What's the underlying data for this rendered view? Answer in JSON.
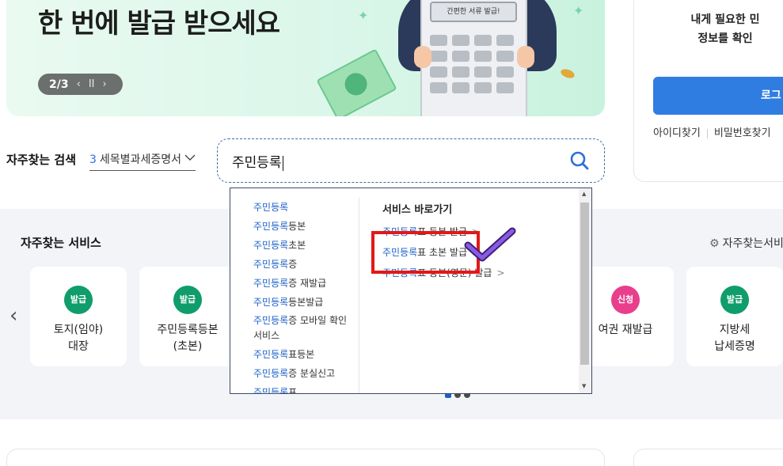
{
  "banner": {
    "title": "한 번에 발급 받으세요",
    "pager": {
      "current": "2",
      "total": "3",
      "separator": "/",
      "prev_icon": "‹",
      "pause_icon": "II",
      "next_icon": "›"
    },
    "calculator_screen": "간편한 서류 발급!"
  },
  "login": {
    "message_line1": "내게 필요한 민",
    "message_line2": "정보를 확인",
    "button_label": "로그",
    "find_id": "아이디찾기",
    "find_password": "비밀번호찾기"
  },
  "frequent_search": {
    "label": "자주찾는 검색",
    "selected_number": "3",
    "selected_text": "세목별과세증명서",
    "chevron_icon": "chevron-down-icon"
  },
  "search": {
    "value": "주민등록",
    "icon": "search-icon",
    "accent_color": "#2d6fdc"
  },
  "dropdown": {
    "suggestions": [
      {
        "hl": "주민등록",
        "rest": ""
      },
      {
        "hl": "주민등록",
        "rest": "등본"
      },
      {
        "hl": "주민등록",
        "rest": "초본"
      },
      {
        "hl": "주민등록",
        "rest": "증"
      },
      {
        "hl": "주민등록",
        "rest": "증 재발급"
      },
      {
        "hl": "주민등록",
        "rest": "등본발급"
      },
      {
        "hl": "주민등록",
        "rest": "증 모바일 확인 서비스"
      },
      {
        "hl": "주민등록",
        "rest": "표등본"
      },
      {
        "hl": "주민등록",
        "rest": "증 분실신고"
      },
      {
        "hl": "주민등록",
        "rest": "표"
      }
    ],
    "shortcut_title": "서비스 바로가기",
    "shortcuts": [
      {
        "hl": "주민등록",
        "rest": "표 등본 발급",
        "arrow": ">"
      },
      {
        "hl": "주민등록",
        "rest": "표 초본 발급",
        "arrow": ">"
      },
      {
        "hl": "주민등록",
        "rest": "표 등본(영문) 발급",
        "arrow": ">"
      }
    ],
    "scroll_up_icon": "▲",
    "scroll_down_icon": "▼"
  },
  "services": {
    "title": "자주찾는 서비스",
    "settings_label": "자주찾는서비",
    "settings_icon": "gear-icon",
    "prev_icon": "‹",
    "cards": [
      {
        "badge": "발급",
        "badge_color": "#0f9d6b",
        "line1": "토지(임야)",
        "line2": "대장"
      },
      {
        "badge": "발급",
        "badge_color": "#0f9d6b",
        "line1": "주민등록등본",
        "line2": "(초본)"
      },
      {
        "badge": "신청",
        "badge_color": "#e83e8c",
        "line1": "여권 재발급",
        "line2": ""
      },
      {
        "badge": "발급",
        "badge_color": "#0f9d6b",
        "line1": "지방세",
        "line2": "납세증명"
      }
    ],
    "page_dots": {
      "total": 3,
      "active": 1
    }
  },
  "annotation": {
    "box_color": "#e21818",
    "check_color": "#6a3fbf"
  }
}
